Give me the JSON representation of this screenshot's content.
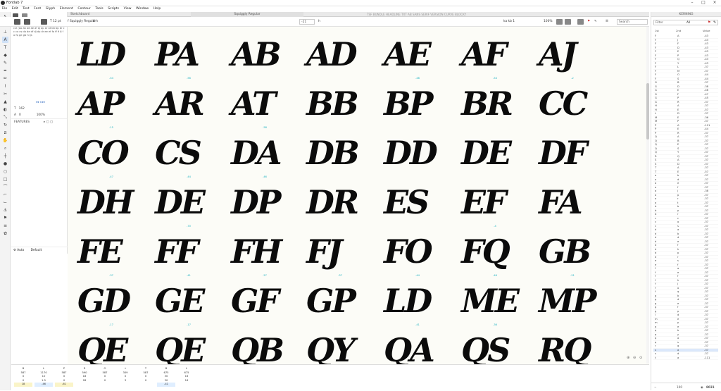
{
  "app": {
    "title": "Fontlab 7",
    "logo_letter": "F"
  },
  "menu": [
    "File",
    "Edit",
    "Text",
    "Font",
    "Glyph",
    "Element",
    "Contour",
    "Tools",
    "Scripts",
    "View",
    "Window",
    "Help"
  ],
  "tabs": {
    "sketchboard": "Sketchboard",
    "font": "Squiggly Regular",
    "ghost_text": "TSF BUNDLE HEADLINE TXT AB SANS SERIF VERSION CURVE BLOCKY"
  },
  "options_bar": {
    "size_label": "T 12 pt",
    "font_label": "f Squiggly Regular",
    "kern_label": "6 h",
    "tracking_value": "-21",
    "tracking_unit": "h",
    "kern_mode": "ka kb 1",
    "zoom": "100%",
    "search_placeholder": "Search"
  },
  "left_panel": {
    "text_header": "TEXT",
    "text_sample": "ci2 (ao ab ad ae af aj ap ar at bb bp br cc co cs da de df dj dp dr ee ef fa ff fi fj fo fq ge gb hi js",
    "size_value": "162",
    "tracking_value": "0",
    "size_pct": "100%",
    "features_label": "FEATURES",
    "footer_left": "Auto",
    "footer_right": "Default"
  },
  "glyph_rows": [
    {
      "pairs": [
        "LD",
        "PA",
        "AB",
        "AD",
        "AE",
        "AF",
        "AJ"
      ],
      "kerns": [
        "",
        "",
        "",
        "",
        "",
        "",
        ""
      ]
    },
    {
      "pairs": [
        "AP",
        "AR",
        "AT",
        "BB",
        "BP",
        "BR",
        "CC"
      ],
      "kerns": [
        "-54",
        "-56",
        "",
        "",
        "-48",
        "-54",
        "-2"
      ]
    },
    {
      "pairs": [
        "CO",
        "CS",
        "DA",
        "DB",
        "DD",
        "DE",
        "DF"
      ],
      "kerns": [
        "-15",
        "",
        "-58",
        "",
        "",
        "",
        ""
      ]
    },
    {
      "pairs": [
        "DH",
        "DE",
        "DP",
        "DR",
        "ES",
        "EF",
        "FA"
      ],
      "kerns": [
        "-47",
        "-44",
        "-46",
        "",
        "",
        "",
        ""
      ]
    },
    {
      "pairs": [
        "FE",
        "FF",
        "FH",
        "FJ",
        "FO",
        "FQ",
        "GB"
      ],
      "kerns": [
        "",
        "-70",
        "",
        "",
        "",
        "-4",
        ""
      ]
    },
    {
      "pairs": [
        "GD",
        "GE",
        "GF",
        "GP",
        "LD",
        "ME",
        "MP"
      ],
      "kerns": [
        "-37",
        "-41",
        "-27",
        "-37",
        "-44",
        "-46",
        "-51"
      ]
    },
    {
      "pairs": [
        "QE",
        "QE",
        "QB",
        "QY",
        "QA",
        "QS",
        "RQ"
      ],
      "kerns": [
        "-17",
        "-17",
        "",
        "",
        "-41",
        "-36",
        ""
      ]
    }
  ],
  "kerning_panel": {
    "title": "KERNING",
    "filter_placeholder": "Filter",
    "filter_value": "All",
    "col1": "1st",
    "col2": "2nd",
    "col3": "Value",
    "rows": [
      [
        "F",
        "A",
        "-43"
      ],
      [
        "F",
        "J",
        "-43"
      ],
      [
        "F",
        "F",
        "-43"
      ],
      [
        "F",
        "D",
        "-43"
      ],
      [
        "F",
        "E",
        "-43"
      ],
      [
        "F",
        "P",
        "-43"
      ],
      [
        "F",
        "Q",
        "-43"
      ],
      [
        "F",
        "Y",
        "-43"
      ],
      [
        "F",
        "L",
        "-37"
      ],
      [
        "F",
        "M",
        "-37"
      ],
      [
        "F",
        "O",
        "-44"
      ],
      [
        "F",
        "S",
        "-44"
      ],
      [
        "G",
        "B",
        "-37"
      ],
      [
        "G",
        "D",
        "-38"
      ],
      [
        "G",
        "E",
        "-46"
      ],
      [
        "G",
        "F",
        "-47"
      ],
      [
        "G",
        "P",
        "-45"
      ],
      [
        "G",
        "R",
        "-37"
      ],
      [
        "H",
        "A",
        "-37"
      ],
      [
        "H",
        "E",
        "-57"
      ],
      [
        "L",
        "D",
        "-37"
      ],
      [
        "M",
        "E",
        "-36"
      ],
      [
        "M",
        "P",
        "-37"
      ],
      [
        "P",
        "A",
        "-111"
      ],
      [
        "P",
        "E",
        "-44"
      ],
      [
        "P",
        "R",
        "-37"
      ],
      [
        "Q",
        "A",
        "-37"
      ],
      [
        "Q",
        "B",
        "-37"
      ],
      [
        "Q",
        "E",
        "-37"
      ],
      [
        "Q",
        "S",
        "-37"
      ],
      [
        "Q",
        "Y",
        "-37"
      ],
      [
        "R",
        "Q",
        "-37"
      ],
      [
        "S",
        "A",
        "-37"
      ],
      [
        "S",
        "D",
        "-37"
      ],
      [
        "T",
        "A",
        "-37"
      ],
      [
        "T",
        "E",
        "-57"
      ],
      [
        "a",
        "b",
        "-37"
      ],
      [
        "a",
        "d",
        "-37"
      ],
      [
        "a",
        "e",
        "-37"
      ],
      [
        "a",
        "f",
        "-37"
      ],
      [
        "a",
        "j",
        "-38"
      ],
      [
        "a",
        "p",
        "-37"
      ],
      [
        "a",
        "r",
        "-37"
      ],
      [
        "a",
        "t",
        "-37"
      ],
      [
        "b",
        "b",
        "-37"
      ],
      [
        "b",
        "p",
        "-37"
      ],
      [
        "b",
        "r",
        "-37"
      ],
      [
        "c",
        "c",
        "-37"
      ],
      [
        "c",
        "o",
        "-37"
      ],
      [
        "c",
        "s",
        "-37"
      ],
      [
        "d",
        "a",
        "-37"
      ],
      [
        "d",
        "b",
        "-37"
      ],
      [
        "d",
        "d",
        "-37"
      ],
      [
        "d",
        "e",
        "-37"
      ],
      [
        "d",
        "f",
        "-37"
      ],
      [
        "d",
        "h",
        "-37"
      ],
      [
        "d",
        "p",
        "-37"
      ],
      [
        "d",
        "r",
        "-37"
      ],
      [
        "e",
        "s",
        "-37"
      ],
      [
        "e",
        "f",
        "-37"
      ],
      [
        "f",
        "a",
        "-37"
      ],
      [
        "f",
        "e",
        "-37"
      ],
      [
        "f",
        "f",
        "-37"
      ],
      [
        "f",
        "h",
        "-37"
      ],
      [
        "f",
        "j",
        "-37"
      ],
      [
        "f",
        "o",
        "-37"
      ],
      [
        "f",
        "q",
        "-37"
      ],
      [
        "g",
        "b",
        "-37"
      ],
      [
        "g",
        "d",
        "-37"
      ],
      [
        "g",
        "e",
        "-37"
      ],
      [
        "g",
        "f",
        "-37"
      ],
      [
        "g",
        "p",
        "-37"
      ],
      [
        "l",
        "d",
        "-37"
      ],
      [
        "m",
        "e",
        "-37"
      ],
      [
        "m",
        "p",
        "-37"
      ],
      [
        "q",
        "e",
        "-37"
      ],
      [
        "q",
        "b",
        "-37"
      ],
      [
        "q",
        "y",
        "-37"
      ],
      [
        "q",
        "a",
        "-37"
      ],
      [
        "q",
        "s",
        "-37"
      ],
      [
        "r",
        "q",
        "-37"
      ],
      [
        "s",
        "a",
        "-37"
      ],
      [
        "s",
        "d",
        "-37"
      ],
      [
        "t",
        "a",
        "-111"
      ]
    ],
    "footer_zoom": "100",
    "footer_count": "8031"
  },
  "metrics_table": {
    "rows": [
      [
        "B",
        "L",
        "P",
        "R",
        "O",
        "+",
        "T",
        "B",
        "L"
      ],
      [
        "587",
        "1170",
        "587",
        "590",
        "587",
        "309",
        "587",
        "675",
        "675"
      ],
      [
        "0",
        "10",
        "0",
        "18",
        "0",
        "0",
        "0",
        "30",
        "16"
      ],
      [
        "0",
        "1.5",
        "0",
        "28",
        "0",
        "3",
        "0",
        "30",
        "16"
      ],
      [
        "18",
        "-46",
        "-61",
        "",
        "",
        "",
        "",
        "-41",
        ""
      ]
    ]
  }
}
